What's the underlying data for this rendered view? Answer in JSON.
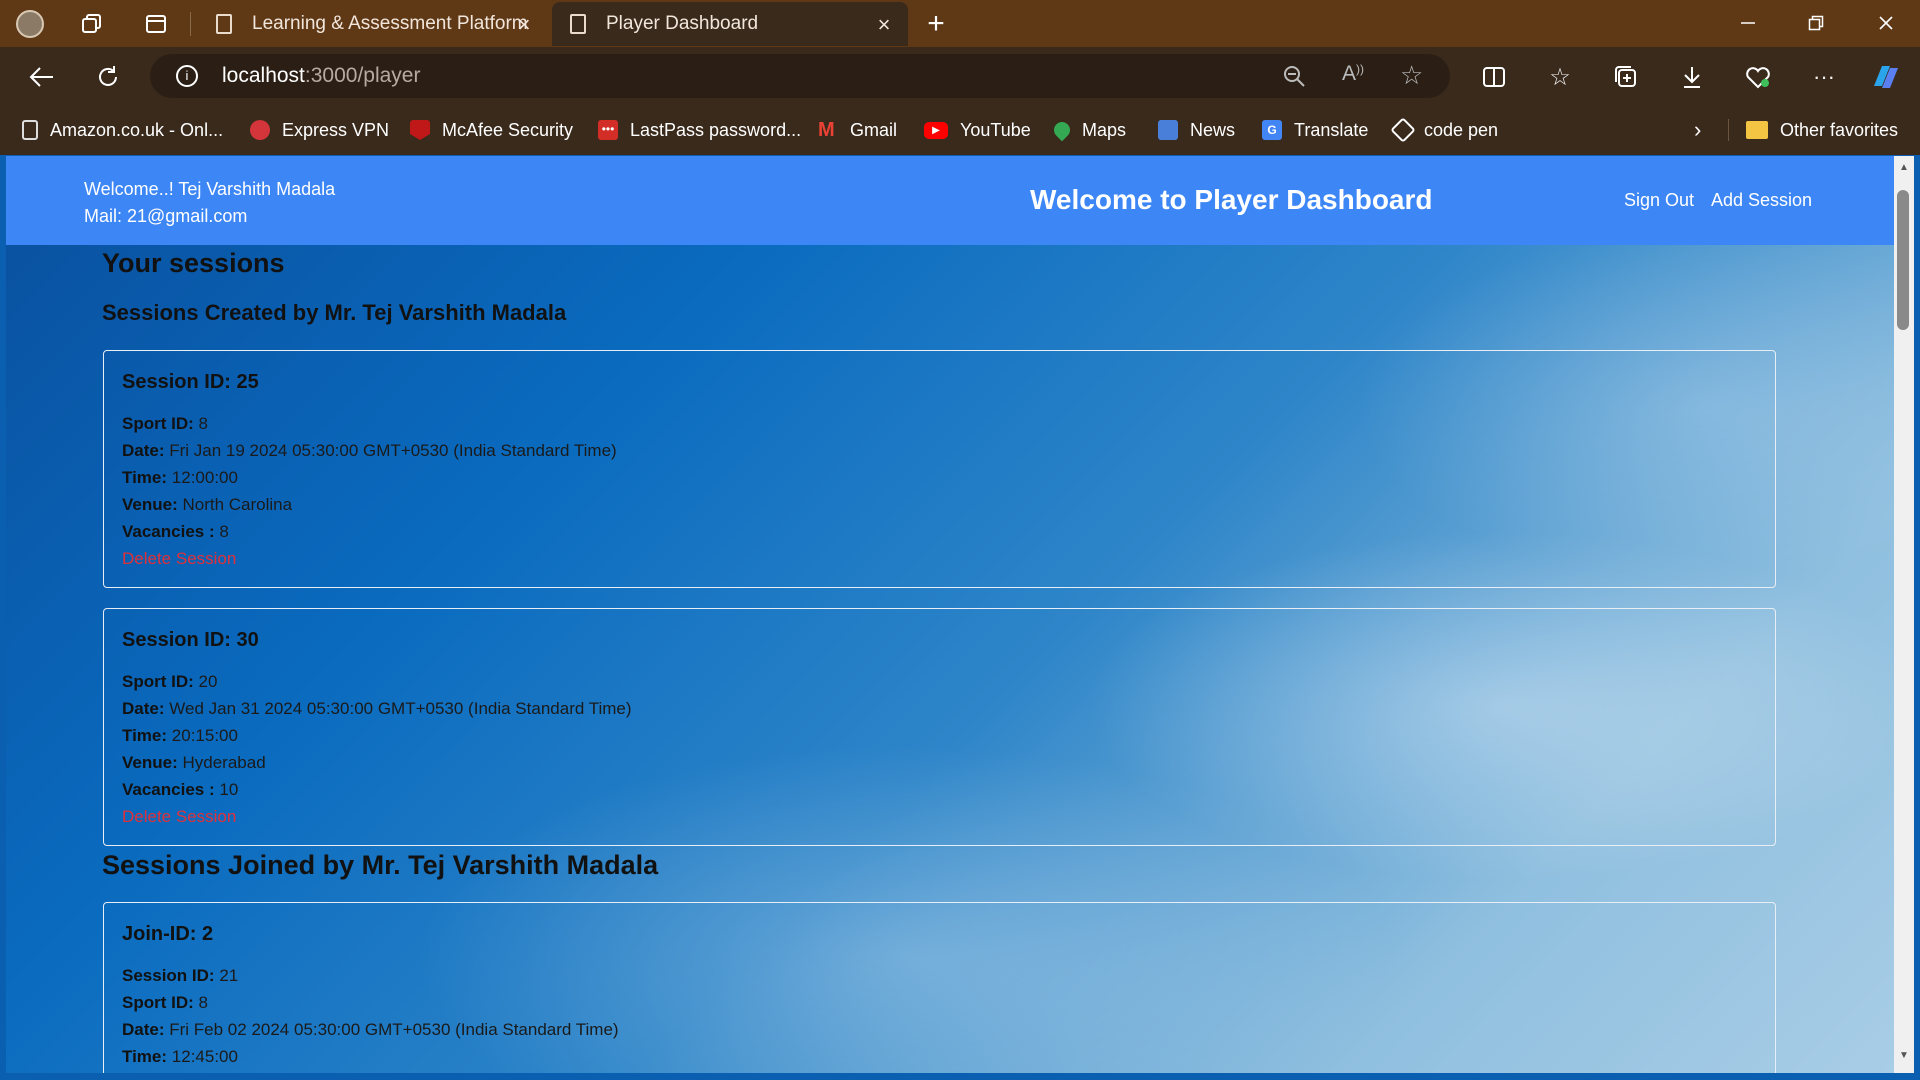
{
  "browser": {
    "tabs": [
      {
        "title": "Learning & Assessment Platform"
      },
      {
        "title": "Player Dashboard"
      }
    ],
    "url_host": "localhost",
    "url_path": ":3000/player",
    "favorites": [
      {
        "label": "Amazon.co.uk - Onl..."
      },
      {
        "label": "Express VPN"
      },
      {
        "label": "McAfee Security"
      },
      {
        "label": "LastPass password..."
      },
      {
        "label": "Gmail"
      },
      {
        "label": "YouTube"
      },
      {
        "label": "Maps"
      },
      {
        "label": "News"
      },
      {
        "label": "Translate"
      },
      {
        "label": "code pen"
      }
    ],
    "other_favorites": "Other favorites"
  },
  "header": {
    "welcome_line": "Welcome..! Tej Varshith Madala",
    "mail_line": "Mail: 21@gmail.com",
    "title": "Welcome to Player Dashboard",
    "sign_out": "Sign Out",
    "add_session": "Add Session"
  },
  "main": {
    "your_sessions": "Your sessions",
    "created_heading": "Sessions Created by Mr. Tej Varshith Madala",
    "joined_heading": "Sessions Joined by Mr. Tej Varshith Madala",
    "labels": {
      "session_id": "Session ID:",
      "sport_id": "Sport ID:",
      "date": "Date:",
      "time": "Time:",
      "venue": "Venue:",
      "vacancies": "Vacancies :",
      "join_id": "Join-ID:"
    },
    "delete_label": "Delete Session",
    "created_sessions": [
      {
        "id": "Session ID: 25",
        "sport_id": "8",
        "date": "Fri Jan 19 2024 05:30:00 GMT+0530 (India Standard Time)",
        "time": "12:00:00",
        "venue": "North Carolina",
        "vacancies": "8"
      },
      {
        "id": "Session ID: 30",
        "sport_id": "20",
        "date": "Wed Jan 31 2024 05:30:00 GMT+0530 (India Standard Time)",
        "time": "20:15:00",
        "venue": "Hyderabad",
        "vacancies": "10"
      }
    ],
    "joined_sessions": [
      {
        "id": "Join-ID: 2",
        "session_id": "21",
        "sport_id": "8",
        "date": "Fri Feb 02 2024 05:30:00 GMT+0530 (India Standard Time)",
        "time": "12:45:00"
      }
    ]
  }
}
